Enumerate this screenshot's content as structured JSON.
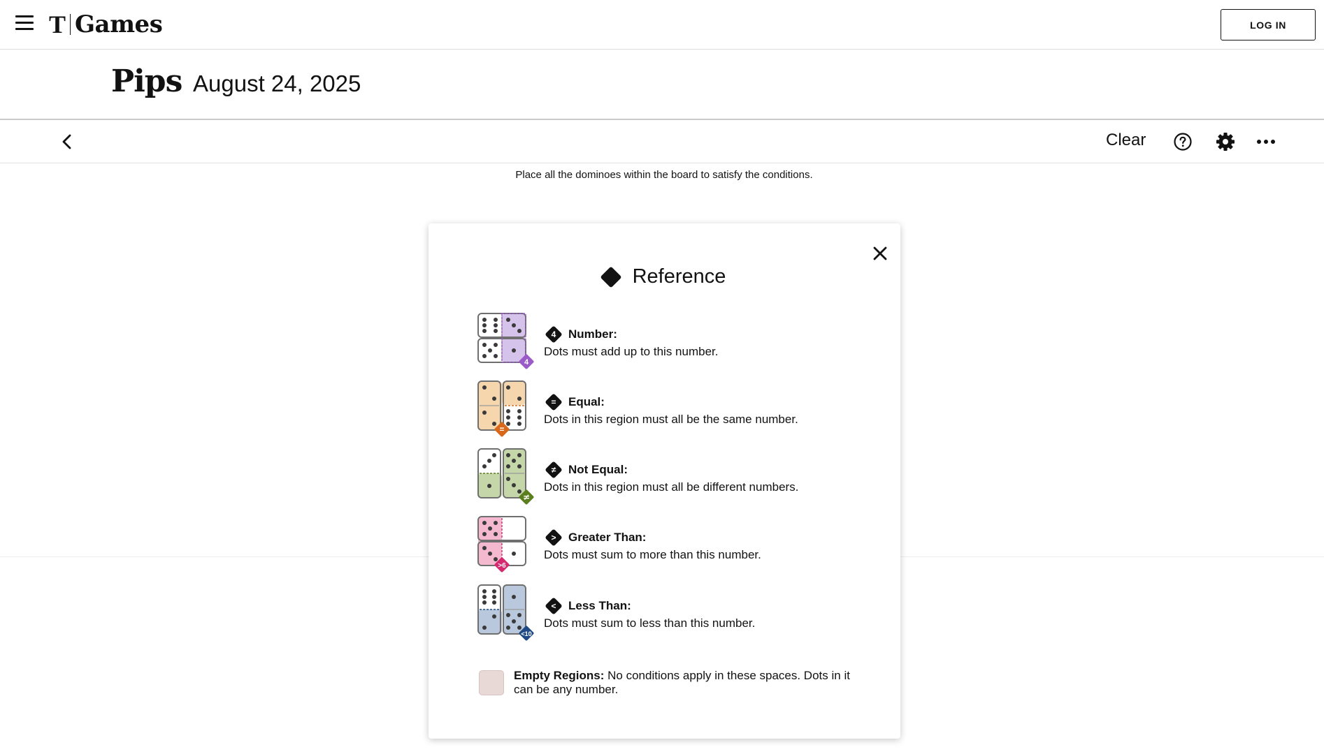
{
  "header": {
    "logo_mark": "T",
    "logo_text": "Games",
    "login_label": "LOG IN"
  },
  "game": {
    "title": "Pips",
    "date": "August 24, 2025"
  },
  "toolbar": {
    "clear_label": "Clear",
    "icons": [
      "back-chevron-icon",
      "help-icon",
      "gear-icon",
      "more-icon"
    ]
  },
  "instructions": "Place all the dominoes within the board to satisfy the conditions.",
  "modal": {
    "title": "Reference",
    "items": [
      {
        "glyph": "4",
        "label": "Number:",
        "desc": "Dots must add up to this number.",
        "badge": "4",
        "color": "#9a5bc9"
      },
      {
        "glyph": "=",
        "label": "Equal:",
        "desc": "Dots in this region must all be the same number.",
        "badge": "=",
        "color": "#d9681a"
      },
      {
        "glyph": "≠",
        "label": "Not Equal:",
        "desc": "Dots in this region must all be different numbers.",
        "badge": "≠",
        "color": "#5b7f1e"
      },
      {
        "glyph": ">",
        "label": "Greater Than:",
        "desc": "Dots must sum to more than this number.",
        "badge": ">6",
        "color": "#d6286f"
      },
      {
        "glyph": "<",
        "label": "Less Than:",
        "desc": "Dots must sum to less than this number.",
        "badge": "<10",
        "color": "#1f4a86"
      }
    ],
    "empty": {
      "label": "Empty Regions:",
      "desc": "No conditions apply in these spaces. Dots in it can be any number.",
      "color": "#e8d9d7"
    }
  }
}
